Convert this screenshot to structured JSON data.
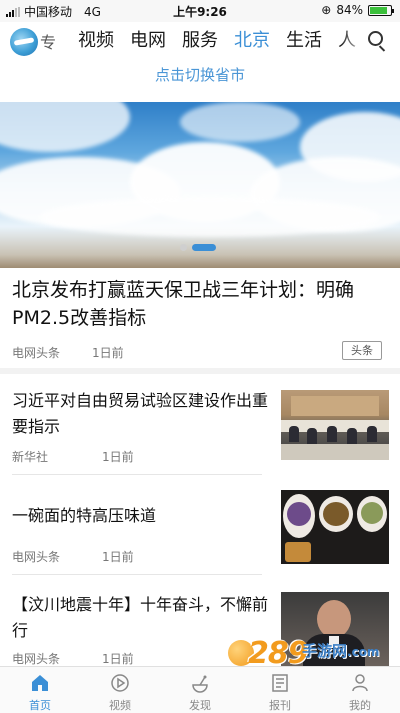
{
  "status_bar": {
    "carrier": "中国移动",
    "network": "4G",
    "time": "上午9:26",
    "battery": "84%",
    "battery_level": 0.84
  },
  "top_nav": {
    "logo_char": "专",
    "tabs": [
      {
        "label": "视频",
        "active": false
      },
      {
        "label": "电网",
        "active": false
      },
      {
        "label": "服务",
        "active": false
      },
      {
        "label": "北京",
        "active": true
      },
      {
        "label": "生活",
        "active": false
      },
      {
        "label": "人",
        "active": false
      }
    ],
    "search_icon": "search-icon"
  },
  "province_switch": "点击切换省市",
  "banner": {
    "image": "blue sky with clouds",
    "page_count": 2,
    "active_index": 1
  },
  "headline": {
    "title": "北京发布打赢蓝天保卫战三年计划：明确PM2.5改善指标",
    "source": "电网头条",
    "time": "1日前",
    "tag": "头条"
  },
  "articles": [
    {
      "title": "习近平对自由贸易试验区建设作出重要指示",
      "source": "新华社",
      "time": "1日前",
      "thumb": "meeting-photo"
    },
    {
      "title": "一碗面的特高压味道",
      "source": "电网头条",
      "time": "1日前",
      "thumb": "bowls-of-food"
    },
    {
      "title": "【汶川地震十年】十年奋斗，不懈前行",
      "source": "电网头条",
      "time": "1日前",
      "thumb": "video-speaker"
    }
  ],
  "watermark": {
    "number": "289",
    "text": "手游网",
    "domain": ".com"
  },
  "tab_bar": [
    {
      "label": "首页",
      "icon": "home-icon",
      "active": true
    },
    {
      "label": "视频",
      "icon": "play-icon",
      "active": false
    },
    {
      "label": "发现",
      "icon": "discover-icon",
      "active": false
    },
    {
      "label": "报刊",
      "icon": "newspaper-icon",
      "active": false
    },
    {
      "label": "我的",
      "icon": "user-icon",
      "active": false
    }
  ],
  "colors": {
    "accent": "#3b8fd6",
    "watermark_orange": "#f29b1e"
  }
}
